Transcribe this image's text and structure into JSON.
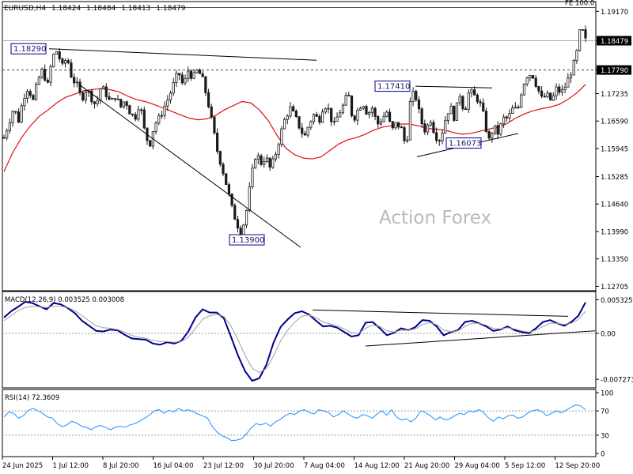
{
  "header": {
    "symbol": "EURUSD,H4",
    "open": "1.18424",
    "high": "1.18484",
    "low": "1.18413",
    "close": "1.18479"
  },
  "watermark": "Action Forex",
  "colors": {
    "candle": "#1a1a1a",
    "ma": "#e01010",
    "macd": "#00008b",
    "signal": "#a0a0a0",
    "rsi": "#1e90ff",
    "label_border": "#00008b",
    "label_text": "#1a1a66"
  },
  "chart_data": [
    {
      "type": "candlestick",
      "panel": "price",
      "x_labels": [
        "24 Jun 2025",
        "1 Jul 12:00",
        "8 Jul 20:00",
        "16 Jul 04:00",
        "23 Jul 12:00",
        "30 Jul 20:00",
        "7 Aug 04:00",
        "14 Aug 12:00",
        "21 Aug 20:00",
        "29 Aug 04:00",
        "5 Sep 12:00",
        "12 Sep 20:00"
      ],
      "y_ticks": [
        "1.19170",
        "1.18479",
        "1.17790",
        "1.17235",
        "1.16590",
        "1.15945",
        "1.15285",
        "1.14640",
        "1.13990",
        "1.13350",
        "1.12705"
      ],
      "ylim": [
        1.1262,
        1.1938
      ],
      "current_price": "1.18479",
      "level_line": "1.17790",
      "fe_level": {
        "label": "FE 100.0",
        "value": 1.1926
      },
      "labels": [
        {
          "text": "1.18290",
          "value": 1.1829
        },
        {
          "text": "1.13900",
          "value": 1.139
        },
        {
          "text": "1.17410",
          "value": 1.1741
        },
        {
          "text": "1.16073",
          "value": 1.16073
        }
      ],
      "close_path": [
        1.162,
        1.1655,
        1.169,
        1.166,
        1.1715,
        1.174,
        1.1705,
        1.1755,
        1.178,
        1.174,
        1.181,
        1.1825,
        1.1785,
        1.181,
        1.176,
        1.1745,
        1.171,
        1.1735,
        1.1715,
        1.1695,
        1.174,
        1.1725,
        1.17,
        1.172,
        1.169,
        1.171,
        1.168,
        1.1665,
        1.1705,
        1.1635,
        1.16,
        1.165,
        1.1665,
        1.169,
        1.1715,
        1.1745,
        1.1775,
        1.174,
        1.1778,
        1.176,
        1.178,
        1.1755,
        1.171,
        1.165,
        1.159,
        1.155,
        1.1505,
        1.1455,
        1.142,
        1.1395,
        1.1445,
        1.1525,
        1.1585,
        1.156,
        1.1575,
        1.1545,
        1.158,
        1.1625,
        1.1665,
        1.169,
        1.167,
        1.1645,
        1.162,
        1.1655,
        1.1675,
        1.166,
        1.17,
        1.1685,
        1.1645,
        1.1675,
        1.1695,
        1.1725,
        1.166,
        1.1685,
        1.1705,
        1.1675,
        1.169,
        1.165,
        1.1665,
        1.168,
        1.1635,
        1.1655,
        1.164,
        1.1595,
        1.1725,
        1.1715,
        1.166,
        1.1635,
        1.1665,
        1.1625,
        1.1615,
        1.166,
        1.1695,
        1.1665,
        1.1725,
        1.168,
        1.173,
        1.1718,
        1.1708,
        1.167,
        1.161,
        1.1645,
        1.163,
        1.1665,
        1.1665,
        1.1688,
        1.1685,
        1.1742,
        1.1768,
        1.177,
        1.174,
        1.171,
        1.172,
        1.1705,
        1.1735,
        1.1725,
        1.1745,
        1.1775,
        1.1805,
        1.1882,
        1.1848
      ],
      "ma_path": [
        1.154,
        1.1585,
        1.162,
        1.1648,
        1.167,
        1.1685,
        1.1702,
        1.1715,
        1.1722,
        1.173,
        1.1733,
        1.1735,
        1.1733,
        1.1728,
        1.1718,
        1.171,
        1.1705,
        1.1698,
        1.169,
        1.1682,
        1.1674,
        1.1666,
        1.1662,
        1.1664,
        1.1672,
        1.1685,
        1.1695,
        1.1705,
        1.1702,
        1.1685,
        1.166,
        1.1625,
        1.1595,
        1.158,
        1.1572,
        1.157,
        1.1575,
        1.159,
        1.1605,
        1.1615,
        1.162,
        1.1628,
        1.1638,
        1.1645,
        1.1648,
        1.1652,
        1.1652,
        1.1648,
        1.1642,
        1.164,
        1.1638,
        1.1632,
        1.1628,
        1.163,
        1.1635,
        1.164,
        1.1645,
        1.1652,
        1.1665,
        1.1675,
        1.1683,
        1.1688,
        1.1692,
        1.1698,
        1.171,
        1.1725,
        1.1745
      ],
      "tops": [
        1.139,
        1.1829
      ],
      "lines": {
        "upper_wedge": [
          [
            1.1829,
            1.1802
          ]
        ],
        "lower_wedge": [
          [
            1.1745,
            1.1362
          ]
        ],
        "resistance": [
          [
            1.1741,
            1.1737
          ]
        ],
        "support": [
          [
            1.1575,
            1.163
          ]
        ]
      }
    },
    {
      "type": "line",
      "panel": "macd",
      "title": "MACD(12,26,9) 0.003525 0.003008",
      "y_ticks": [
        "0.005325",
        "0.00",
        "-0.007273"
      ],
      "ylim": [
        -0.0085,
        0.0065
      ],
      "series": [
        {
          "name": "MACD",
          "values": [
            0.0025,
            0.0035,
            0.0042,
            0.005,
            0.0048,
            0.0043,
            0.0038,
            0.0048,
            0.0046,
            0.004,
            0.0032,
            0.002,
            0.0012,
            0.0004,
            0.0003,
            0.0006,
            0.0005,
            -0.0002,
            -0.0008,
            -0.0009,
            -0.001,
            -0.0016,
            -0.0018,
            -0.0014,
            -0.0016,
            -0.0012,
            0.0003,
            0.0025,
            0.0038,
            0.0033,
            0.0033,
            0.0024,
            -0.0005,
            -0.0035,
            -0.006,
            -0.0075,
            -0.0071,
            -0.005,
            -0.0015,
            0.001,
            0.0022,
            0.0032,
            0.0035,
            0.003,
            0.002,
            0.0011,
            0.0012,
            0.0009,
            0.0002,
            -0.0005,
            -0.0003,
            0.0017,
            0.0018,
            0.0008,
            -0.0003,
            0.0001,
            0.0008,
            0.0005,
            0.001,
            0.0021,
            0.002,
            0.0011,
            -0.0003,
            0.0002,
            0.0005,
            0.0018,
            0.002,
            0.0016,
            0.0011,
            0.0004,
            0.0006,
            0.0011,
            0.0005,
            0.0002,
            0.0,
            0.0008,
            0.0018,
            0.0021,
            0.0016,
            0.0012,
            0.0018,
            0.0028,
            0.0049
          ]
        },
        {
          "name": "Signal",
          "values": [
            0.002,
            0.0028,
            0.0036,
            0.0041,
            0.0043,
            0.0042,
            0.0041,
            0.0043,
            0.0043,
            0.0041,
            0.0036,
            0.0028,
            0.002,
            0.0012,
            0.0009,
            0.0008,
            0.0006,
            0.0002,
            -0.0003,
            -0.0006,
            -0.0008,
            -0.0011,
            -0.0013,
            -0.0013,
            -0.0014,
            -0.0013,
            -0.0006,
            0.0008,
            0.0022,
            0.0028,
            0.003,
            0.0027,
            0.0012,
            -0.001,
            -0.0035,
            -0.0055,
            -0.0062,
            -0.0056,
            -0.0036,
            -0.0012,
            0.0005,
            0.0018,
            0.0027,
            0.0029,
            0.0025,
            0.0018,
            0.0015,
            0.0012,
            0.0007,
            0.0001,
            0.0,
            0.0008,
            0.0013,
            0.0011,
            0.0004,
            0.0002,
            0.0005,
            0.0005,
            0.0007,
            0.0014,
            0.0017,
            0.0014,
            0.0005,
            0.0003,
            0.0004,
            0.0011,
            0.0016,
            0.0016,
            0.0013,
            0.0008,
            0.0007,
            0.0009,
            0.0007,
            0.0004,
            0.0002,
            0.0005,
            0.0011,
            0.0016,
            0.0016,
            0.0014,
            0.0016,
            0.0022,
            0.0035
          ]
        }
      ]
    },
    {
      "type": "line",
      "panel": "rsi",
      "title": "RSI(14) 72.3609",
      "y_ticks": [
        "100",
        "70",
        "30",
        "0"
      ],
      "ylim": [
        0,
        100
      ],
      "series": [
        {
          "name": "RSI",
          "values": [
            60,
            68,
            66,
            58,
            62,
            71,
            74,
            70,
            66,
            60,
            58,
            49,
            44,
            47,
            53,
            50,
            45,
            43,
            39,
            44,
            46,
            43,
            39,
            43,
            45,
            43,
            47,
            49,
            53,
            58,
            63,
            70,
            72,
            66,
            71,
            68,
            74,
            70,
            72,
            69,
            65,
            62,
            58,
            44,
            35,
            29,
            26,
            21,
            22,
            24,
            32,
            42,
            49,
            47,
            50,
            45,
            52,
            56,
            62,
            66,
            64,
            70,
            72,
            67,
            65,
            72,
            70,
            67,
            60,
            64,
            70,
            65,
            60,
            58,
            64,
            62,
            58,
            65,
            70,
            63,
            72,
            60,
            55,
            57,
            52,
            58,
            70,
            67,
            62,
            55,
            60,
            55,
            57,
            62,
            66,
            64,
            70,
            68,
            72,
            67,
            58,
            53,
            60,
            57,
            62,
            63,
            58,
            60,
            66,
            70,
            72,
            69,
            62,
            66,
            70,
            67,
            71,
            76,
            80,
            78,
            72
          ]
        }
      ]
    }
  ]
}
